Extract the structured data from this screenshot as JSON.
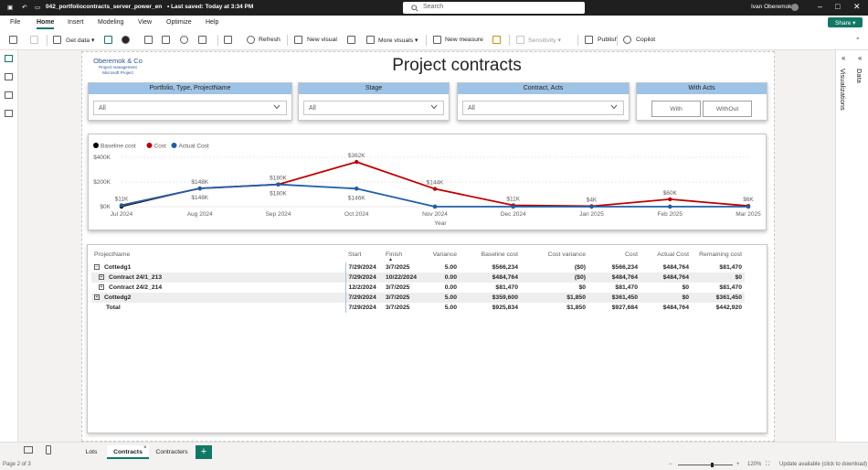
{
  "titlebar": {
    "filename": "042_portfoliocontracts_server_power_en",
    "saved": "• Last saved: Today at 3:34 PM",
    "search_placeholder": "Search",
    "user": "Ivan Oberemok"
  },
  "menu": {
    "items": [
      "File",
      "Home",
      "Insert",
      "Modeling",
      "View",
      "Optimize",
      "Help"
    ],
    "active": "Home",
    "share": "Share"
  },
  "ribbon": {
    "get_data": "Get data",
    "refresh": "Refresh",
    "new_visual": "New visual",
    "more_visuals": "More visuals",
    "new_measure": "New measure",
    "sensitivity": "Sensitivity",
    "publish": "Publish",
    "copilot": "Copilot"
  },
  "logo": {
    "name": "Oberemok & Co",
    "line2": "Project management",
    "line3": "Microsoft Project"
  },
  "page_title": "Project contracts",
  "slicers": {
    "portfolio": {
      "header": "Portfolio, Type, ProjectName",
      "value": "All"
    },
    "stage": {
      "header": "Stage",
      "value": "All"
    },
    "contract": {
      "header": "Contract, Acts",
      "value": "All"
    },
    "acts": {
      "header": "With Acts",
      "with": "With",
      "without": "WithOut"
    }
  },
  "chart_data": {
    "type": "line",
    "categories": [
      "Jul 2024",
      "Aug 2024",
      "Sep 2024",
      "Oct 2024",
      "Nov 2024",
      "Dec 2024",
      "Jan 2025",
      "Feb 2025",
      "Mar 2025"
    ],
    "xlabel": "Year",
    "ylabel": "",
    "ylim": [
      0,
      400
    ],
    "y_ticks": [
      "$0K",
      "$200K",
      "$400K"
    ],
    "legend_placement": "top-left",
    "series": [
      {
        "name": "Baseline cost",
        "color": "#000000",
        "values": [
          0,
          148,
          180,
          146,
          0,
          0,
          0,
          0,
          0
        ],
        "labels": [
          "",
          "$148K",
          "$180K",
          "$146K",
          "",
          "",
          "",
          "",
          ""
        ]
      },
      {
        "name": "Cost",
        "color": "#c00000",
        "values": [
          11,
          148,
          180,
          362,
          144,
          11,
          4,
          60,
          6
        ],
        "labels": [
          "$11K",
          "$148K",
          "$180K",
          "$362K",
          "$144K",
          "$11K",
          "$4K",
          "$60K",
          "$6K"
        ]
      },
      {
        "name": "Actual Cost",
        "color": "#1f5fa8",
        "values": [
          11,
          148,
          180,
          146,
          0,
          0,
          0,
          0,
          0
        ],
        "labels": [
          "",
          "$148K",
          "$180K",
          "$146K",
          "",
          "",
          "",
          "",
          ""
        ]
      }
    ]
  },
  "table": {
    "columns": [
      "ProjectName",
      "Start",
      "Finish",
      "Variance",
      "Baseline cost",
      "Cost variance",
      "Cost",
      "Actual Cost",
      "Remaining cost"
    ],
    "rows": [
      {
        "expander": "−",
        "indent": 0,
        "name": "Cottedg1",
        "start": "7/29/2024",
        "finish": "3/7/2025",
        "variance": "5.00",
        "baseline": "$566,234",
        "costvar": "($0)",
        "cost": "$566,234",
        "actual": "$484,764",
        "remaining": "$81,470"
      },
      {
        "expander": "+",
        "indent": 1,
        "name": "Contract 24/1_213",
        "start": "7/29/2024",
        "finish": "10/22/2024",
        "variance": "0.00",
        "baseline": "$484,764",
        "costvar": "($0)",
        "cost": "$484,764",
        "actual": "$484,764",
        "remaining": "$0"
      },
      {
        "expander": "+",
        "indent": 1,
        "name": "Contract 24/2_214",
        "start": "12/2/2024",
        "finish": "3/7/2025",
        "variance": "0.00",
        "baseline": "$81,470",
        "costvar": "$0",
        "cost": "$81,470",
        "actual": "$0",
        "remaining": "$81,470"
      },
      {
        "expander": "+",
        "indent": 0,
        "name": "Cottedg2",
        "start": "7/29/2024",
        "finish": "3/7/2025",
        "variance": "5.00",
        "baseline": "$359,600",
        "costvar": "$1,850",
        "cost": "$361,450",
        "actual": "$0",
        "remaining": "$361,450"
      }
    ],
    "total": {
      "name": "Total",
      "start": "7/29/2024",
      "finish": "3/7/2025",
      "variance": "5.00",
      "baseline": "$925,834",
      "costvar": "$1,850",
      "cost": "$927,684",
      "actual": "$484,764",
      "remaining": "$442,920"
    }
  },
  "page_tabs": [
    "Lots",
    "Contracts",
    "Contracters"
  ],
  "active_tab": "Contracts",
  "right_pane": {
    "data": "Data",
    "visualizations": "Visualizations"
  },
  "status": {
    "page": "Page 2 of 3",
    "zoom": "120%",
    "update": "Update available (click to download)"
  }
}
